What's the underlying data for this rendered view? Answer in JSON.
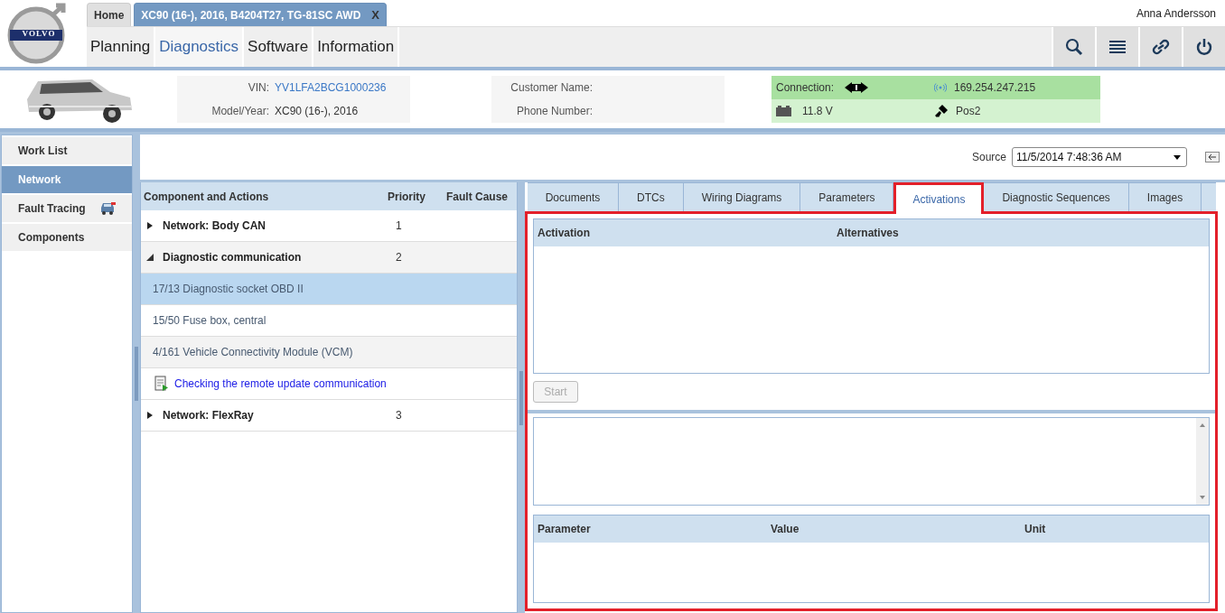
{
  "logo_text": "VOLVO",
  "top_tabs": [
    {
      "label": "Home",
      "selected": false
    },
    {
      "label": "XC90 (16-), 2016, B4204T27, TG-81SC AWD",
      "selected": true,
      "close": "X"
    }
  ],
  "user": "Anna Andersson",
  "nav": [
    {
      "label": "Planning",
      "selected": false
    },
    {
      "label": "Diagnostics",
      "selected": true
    },
    {
      "label": "Software",
      "selected": false
    },
    {
      "label": "Information",
      "selected": false
    }
  ],
  "vehicle": {
    "vin_label": "VIN:",
    "vin": "YV1LFA2BCG1000236",
    "model_label": "Model/Year:",
    "model": "XC90 (16-), 2016",
    "customer_label": "Customer Name:",
    "phone_label": "Phone Number:"
  },
  "status": {
    "connection_label": "Connection:",
    "ip": "169.254.247.215",
    "voltage": "11.8 V",
    "key_position": "Pos2"
  },
  "sidebar": [
    {
      "label": "Work List",
      "selected": false,
      "badge": false
    },
    {
      "label": "Network",
      "selected": true,
      "badge": false
    },
    {
      "label": "Fault Tracing",
      "selected": false,
      "badge": true
    },
    {
      "label": "Components",
      "selected": false,
      "badge": false
    }
  ],
  "source": {
    "label": "Source",
    "value": "11/5/2014 7:48:36 AM"
  },
  "tree": {
    "columns": [
      "Component and Actions",
      "Priority",
      "Fault Cause"
    ],
    "items": [
      {
        "label": "Network: Body CAN",
        "priority": "1",
        "expanded": false
      },
      {
        "label": "Diagnostic communication",
        "priority": "2",
        "expanded": true,
        "children": [
          {
            "kind": "component",
            "label": "17/13 Diagnostic socket OBD II",
            "selected": true
          },
          {
            "kind": "component",
            "label": "15/50 Fuse box, central",
            "selected": false
          },
          {
            "kind": "component",
            "label": "4/161 Vehicle Connectivity Module (VCM)",
            "selected": false
          },
          {
            "kind": "action",
            "label": "Checking the remote update communication",
            "selected": false
          }
        ]
      },
      {
        "label": "Network: FlexRay",
        "priority": "3",
        "expanded": false
      }
    ]
  },
  "tabs": [
    {
      "label": "Documents",
      "selected": false
    },
    {
      "label": "DTCs",
      "selected": false
    },
    {
      "label": "Wiring Diagrams",
      "selected": false
    },
    {
      "label": "Parameters",
      "selected": false
    },
    {
      "label": "Activations",
      "selected": true
    },
    {
      "label": "Diagnostic Sequences",
      "selected": false
    },
    {
      "label": "Images",
      "selected": false
    }
  ],
  "activation_table": {
    "columns": [
      "Activation",
      "Alternatives"
    ]
  },
  "start_button": {
    "label": "Start",
    "disabled": true
  },
  "parameter_table": {
    "columns": [
      "Parameter",
      "Value",
      "Unit"
    ]
  }
}
